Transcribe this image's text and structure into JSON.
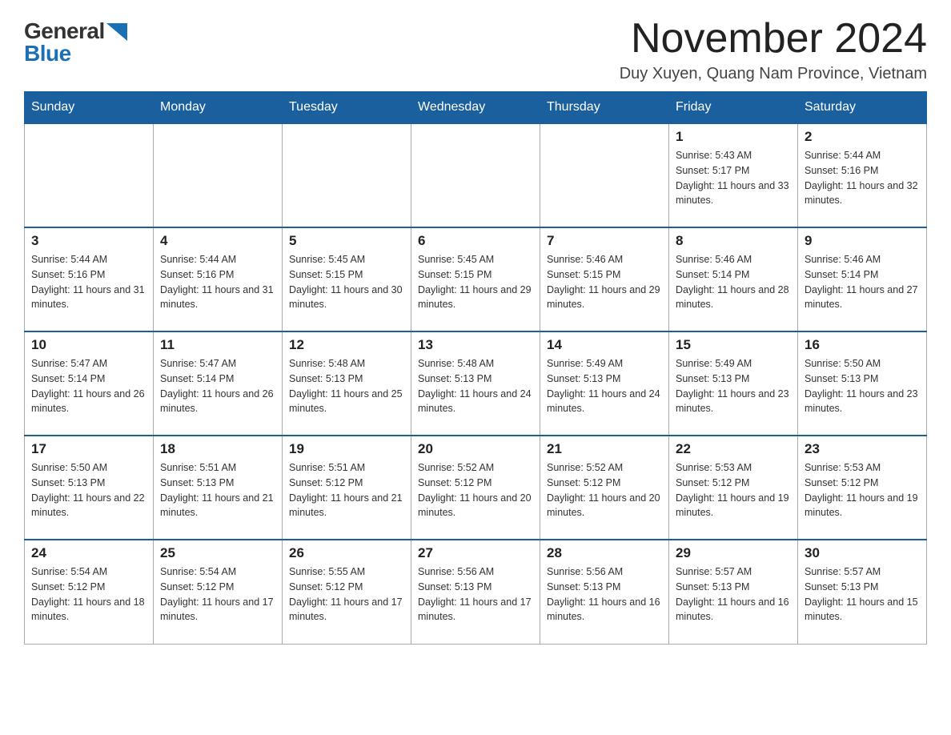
{
  "logo": {
    "general": "General",
    "blue": "Blue"
  },
  "title": "November 2024",
  "location": "Duy Xuyen, Quang Nam Province, Vietnam",
  "weekdays": [
    "Sunday",
    "Monday",
    "Tuesday",
    "Wednesday",
    "Thursday",
    "Friday",
    "Saturday"
  ],
  "weeks": [
    [
      {
        "day": "",
        "info": ""
      },
      {
        "day": "",
        "info": ""
      },
      {
        "day": "",
        "info": ""
      },
      {
        "day": "",
        "info": ""
      },
      {
        "day": "",
        "info": ""
      },
      {
        "day": "1",
        "info": "Sunrise: 5:43 AM\nSunset: 5:17 PM\nDaylight: 11 hours and 33 minutes."
      },
      {
        "day": "2",
        "info": "Sunrise: 5:44 AM\nSunset: 5:16 PM\nDaylight: 11 hours and 32 minutes."
      }
    ],
    [
      {
        "day": "3",
        "info": "Sunrise: 5:44 AM\nSunset: 5:16 PM\nDaylight: 11 hours and 31 minutes."
      },
      {
        "day": "4",
        "info": "Sunrise: 5:44 AM\nSunset: 5:16 PM\nDaylight: 11 hours and 31 minutes."
      },
      {
        "day": "5",
        "info": "Sunrise: 5:45 AM\nSunset: 5:15 PM\nDaylight: 11 hours and 30 minutes."
      },
      {
        "day": "6",
        "info": "Sunrise: 5:45 AM\nSunset: 5:15 PM\nDaylight: 11 hours and 29 minutes."
      },
      {
        "day": "7",
        "info": "Sunrise: 5:46 AM\nSunset: 5:15 PM\nDaylight: 11 hours and 29 minutes."
      },
      {
        "day": "8",
        "info": "Sunrise: 5:46 AM\nSunset: 5:14 PM\nDaylight: 11 hours and 28 minutes."
      },
      {
        "day": "9",
        "info": "Sunrise: 5:46 AM\nSunset: 5:14 PM\nDaylight: 11 hours and 27 minutes."
      }
    ],
    [
      {
        "day": "10",
        "info": "Sunrise: 5:47 AM\nSunset: 5:14 PM\nDaylight: 11 hours and 26 minutes."
      },
      {
        "day": "11",
        "info": "Sunrise: 5:47 AM\nSunset: 5:14 PM\nDaylight: 11 hours and 26 minutes."
      },
      {
        "day": "12",
        "info": "Sunrise: 5:48 AM\nSunset: 5:13 PM\nDaylight: 11 hours and 25 minutes."
      },
      {
        "day": "13",
        "info": "Sunrise: 5:48 AM\nSunset: 5:13 PM\nDaylight: 11 hours and 24 minutes."
      },
      {
        "day": "14",
        "info": "Sunrise: 5:49 AM\nSunset: 5:13 PM\nDaylight: 11 hours and 24 minutes."
      },
      {
        "day": "15",
        "info": "Sunrise: 5:49 AM\nSunset: 5:13 PM\nDaylight: 11 hours and 23 minutes."
      },
      {
        "day": "16",
        "info": "Sunrise: 5:50 AM\nSunset: 5:13 PM\nDaylight: 11 hours and 23 minutes."
      }
    ],
    [
      {
        "day": "17",
        "info": "Sunrise: 5:50 AM\nSunset: 5:13 PM\nDaylight: 11 hours and 22 minutes."
      },
      {
        "day": "18",
        "info": "Sunrise: 5:51 AM\nSunset: 5:13 PM\nDaylight: 11 hours and 21 minutes."
      },
      {
        "day": "19",
        "info": "Sunrise: 5:51 AM\nSunset: 5:12 PM\nDaylight: 11 hours and 21 minutes."
      },
      {
        "day": "20",
        "info": "Sunrise: 5:52 AM\nSunset: 5:12 PM\nDaylight: 11 hours and 20 minutes."
      },
      {
        "day": "21",
        "info": "Sunrise: 5:52 AM\nSunset: 5:12 PM\nDaylight: 11 hours and 20 minutes."
      },
      {
        "day": "22",
        "info": "Sunrise: 5:53 AM\nSunset: 5:12 PM\nDaylight: 11 hours and 19 minutes."
      },
      {
        "day": "23",
        "info": "Sunrise: 5:53 AM\nSunset: 5:12 PM\nDaylight: 11 hours and 19 minutes."
      }
    ],
    [
      {
        "day": "24",
        "info": "Sunrise: 5:54 AM\nSunset: 5:12 PM\nDaylight: 11 hours and 18 minutes."
      },
      {
        "day": "25",
        "info": "Sunrise: 5:54 AM\nSunset: 5:12 PM\nDaylight: 11 hours and 17 minutes."
      },
      {
        "day": "26",
        "info": "Sunrise: 5:55 AM\nSunset: 5:12 PM\nDaylight: 11 hours and 17 minutes."
      },
      {
        "day": "27",
        "info": "Sunrise: 5:56 AM\nSunset: 5:13 PM\nDaylight: 11 hours and 17 minutes."
      },
      {
        "day": "28",
        "info": "Sunrise: 5:56 AM\nSunset: 5:13 PM\nDaylight: 11 hours and 16 minutes."
      },
      {
        "day": "29",
        "info": "Sunrise: 5:57 AM\nSunset: 5:13 PM\nDaylight: 11 hours and 16 minutes."
      },
      {
        "day": "30",
        "info": "Sunrise: 5:57 AM\nSunset: 5:13 PM\nDaylight: 11 hours and 15 minutes."
      }
    ]
  ]
}
